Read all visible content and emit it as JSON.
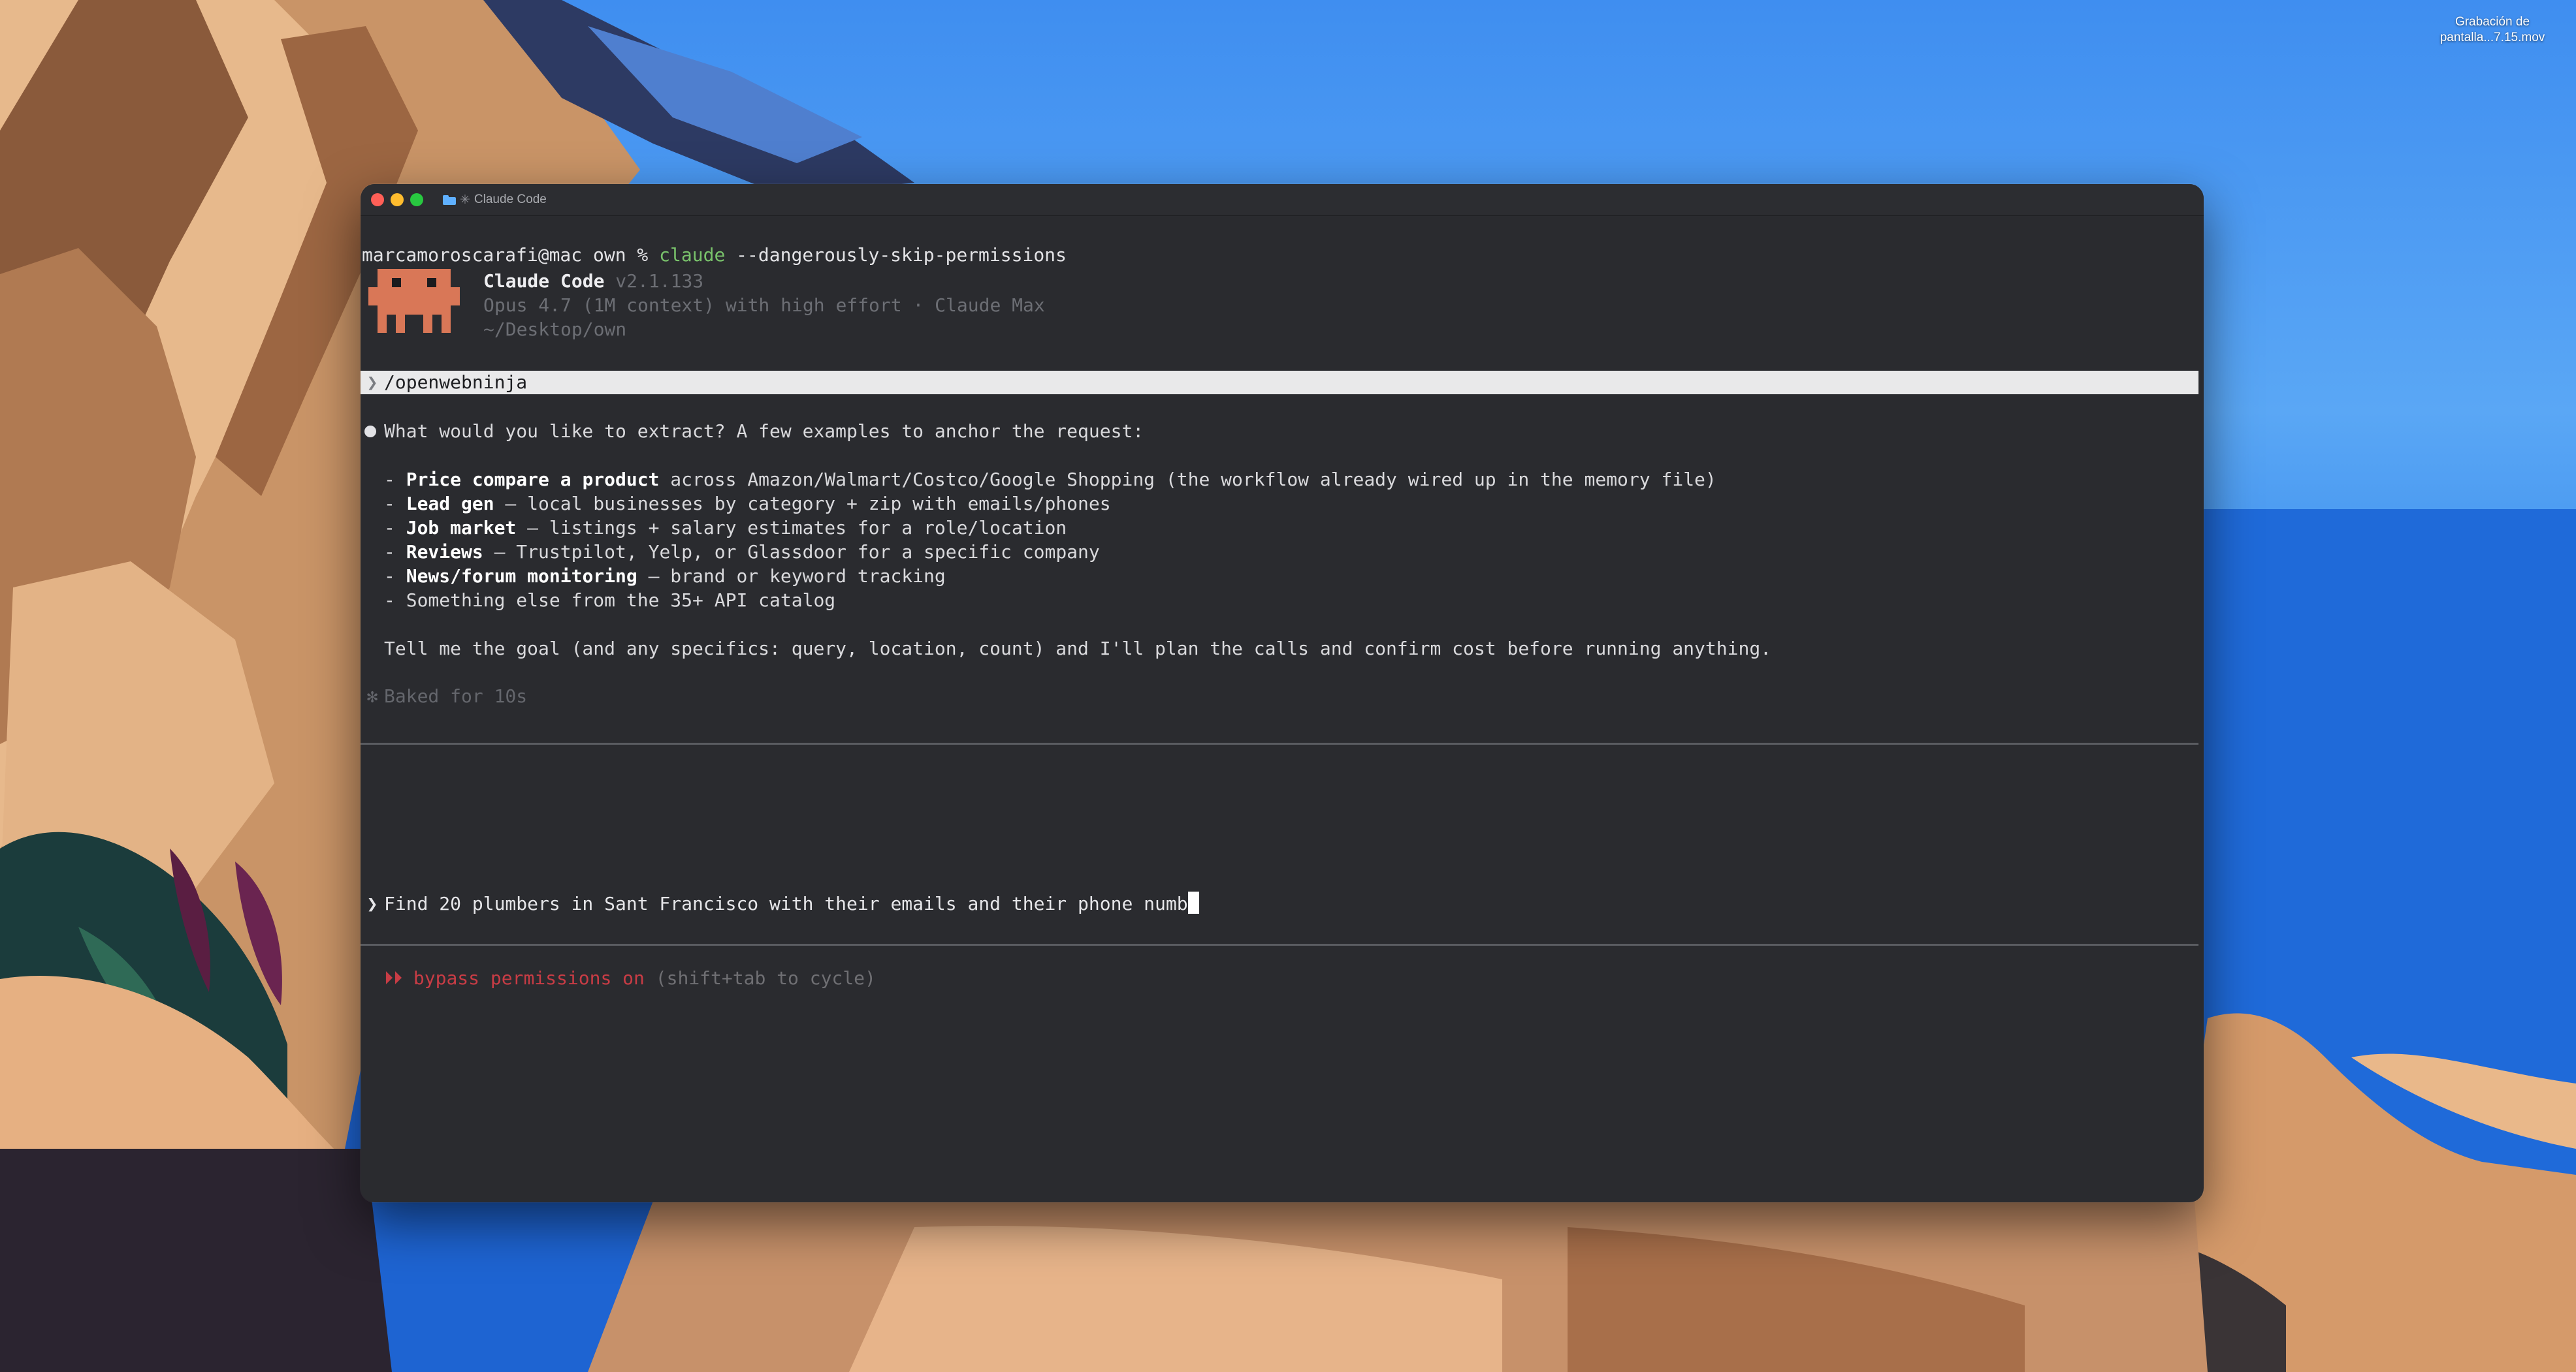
{
  "desktop": {
    "file_label_line1": "Grabación de",
    "file_label_line2": "pantalla...7.15.mov"
  },
  "window": {
    "title": "Claude Code",
    "title_prefix": "✳"
  },
  "terminal": {
    "prompt": "marcamoroscarafi@mac own % ",
    "command_name": "claude",
    "command_args": " --dangerously-skip-permissions",
    "app_name": "Claude Code",
    "app_version": " v2.1.133",
    "model_line": "Opus 4.7 (1M context) with high effort · Claude Max",
    "path_line": "~/Desktop/own",
    "slash_chevron": "❯",
    "slash_command": "/openwebninja",
    "response_intro": "What would you like to extract? A few examples to anchor the request:",
    "items": [
      {
        "bold": "Price compare a product",
        "rest": " across Amazon/Walmart/Costco/Google Shopping (the workflow already wired up in the memory file)"
      },
      {
        "bold": "Lead gen",
        "rest": " — local businesses by category + zip with emails/phones"
      },
      {
        "bold": "Job market",
        "rest": " — listings + salary estimates for a role/location"
      },
      {
        "bold": "Reviews",
        "rest": " — Trustpilot, Yelp, or Glassdoor for a specific company"
      },
      {
        "bold": "News/forum monitoring",
        "rest": " — brand or keyword tracking"
      },
      {
        "bold": "",
        "rest": "Something else from the 35+ API catalog"
      }
    ],
    "item_prefix": "- ",
    "response_outro": "Tell me the goal (and any specifics: query, location, count) and I'll plan the calls and confirm cost before running anything.",
    "baked_star": "✻",
    "baked_text": "Baked for 10s",
    "input_chevron": "❯",
    "input_text": "Find 20 plumbers in Sant Francisco with their emails and their phone numb",
    "bypass_arrows": "⏵⏵",
    "bypass_label": " bypass permissions on",
    "bypass_hint": " (shift+tab to cycle)"
  },
  "colors": {
    "terminal_bg": "#2a2b2f",
    "claude_orange": "#d97757",
    "command_green": "#79c26b",
    "bypass_red": "#c83c45"
  }
}
